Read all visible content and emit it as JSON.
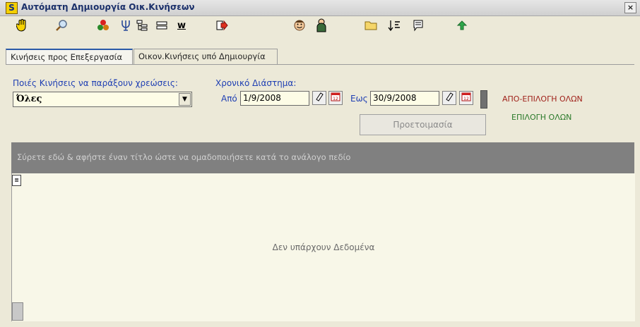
{
  "window": {
    "logo_letter": "S",
    "title": "Αυτόματη Δημιουργία Οικ.Κινήσεων",
    "close_label": "×"
  },
  "toolbar": {
    "icons": [
      "hand-icon",
      "magnifier-icon",
      "molecule-icon",
      "fork-icon",
      "tree-icon",
      "list-icon",
      "underline-w-icon",
      "arrow-right-icon",
      "smile-icon",
      "person-icon",
      "folder-icon",
      "sort-icon",
      "note-icon",
      "up-arrow-icon"
    ],
    "w_label": "w"
  },
  "tabs": [
    {
      "label": "Κινήσεις προς Επεξεργασία",
      "active": true
    },
    {
      "label": "Οικον.Κινήσεις υπό Δημιουργία",
      "active": false
    }
  ],
  "filters": {
    "charges_label": "Ποιές Κινήσεις να παράξουν χρεώσεις:",
    "charges_value": "Όλες",
    "period_label": "Χρονικό Διάστημα:",
    "from_label": "Από",
    "from_value": "1/9/2008",
    "to_label": "Εως",
    "to_value": "30/9/2008"
  },
  "actions": {
    "deselect_all": "ΑΠΟ-ΕΠΙΛΟΓΗ ΟΛΩΝ",
    "select_all": "ΕΠΙΛΟΓΗ ΟΛΩΝ",
    "prepare": "Προετοιμασία"
  },
  "grid": {
    "group_hint": "Σύρετε εδώ & αφήστε έναν τίτλο ώστε να ομαδοποιήσετε κατά το ανάλογο πεδίο",
    "no_data": "Δεν υπάρχουν Δεδομένα"
  },
  "colors": {
    "accent_blue": "#1f3fb3",
    "deselect_red": "#a0221b",
    "select_green": "#2a7a2a"
  }
}
